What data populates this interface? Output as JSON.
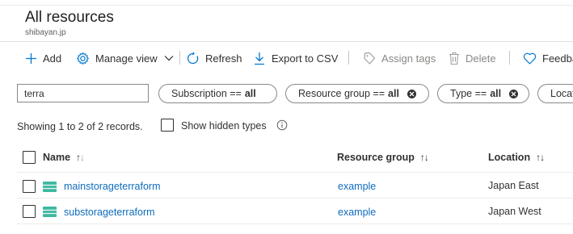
{
  "header": {
    "title": "All resources",
    "subtitle": "shibayan.jp"
  },
  "toolbar": {
    "add": {
      "label": "Add",
      "icon": "plus-icon"
    },
    "manage_view": {
      "label": "Manage view",
      "icon": "gear-icon"
    },
    "refresh": {
      "label": "Refresh",
      "icon": "refresh-icon"
    },
    "export_csv": {
      "label": "Export to CSV",
      "icon": "download-icon"
    },
    "assign_tags": {
      "label": "Assign tags",
      "icon": "tag-icon"
    },
    "delete": {
      "label": "Delete",
      "icon": "trash-icon"
    },
    "feedback": {
      "label": "Feedba",
      "icon": "heart-icon"
    }
  },
  "filters": {
    "search_value": "terra",
    "subscription": {
      "label": "Subscription ==",
      "value": "all"
    },
    "resource_group": {
      "label": "Resource group ==",
      "value": "all"
    },
    "type": {
      "label": "Type ==",
      "value": "all"
    },
    "location": {
      "label": "Locat"
    }
  },
  "records_text": "Showing 1 to 2 of 2 records.",
  "show_hidden_types": {
    "label": "Show hidden types",
    "checked": false
  },
  "table": {
    "columns": [
      {
        "label": "Name"
      },
      {
        "label": "Resource group"
      },
      {
        "label": "Location"
      }
    ],
    "rows": [
      {
        "name": "mainstorageterraform",
        "resource_group": "example",
        "location": "Japan East",
        "icon": "storage-account-icon"
      },
      {
        "name": "substorageterraform",
        "resource_group": "example",
        "location": "Japan West",
        "icon": "storage-account-icon"
      }
    ]
  },
  "colors": {
    "link": "#0f6cbd",
    "toolbar_icon": "#0078d4",
    "text": "#323130",
    "storage_icon": "#3eb8a0"
  }
}
